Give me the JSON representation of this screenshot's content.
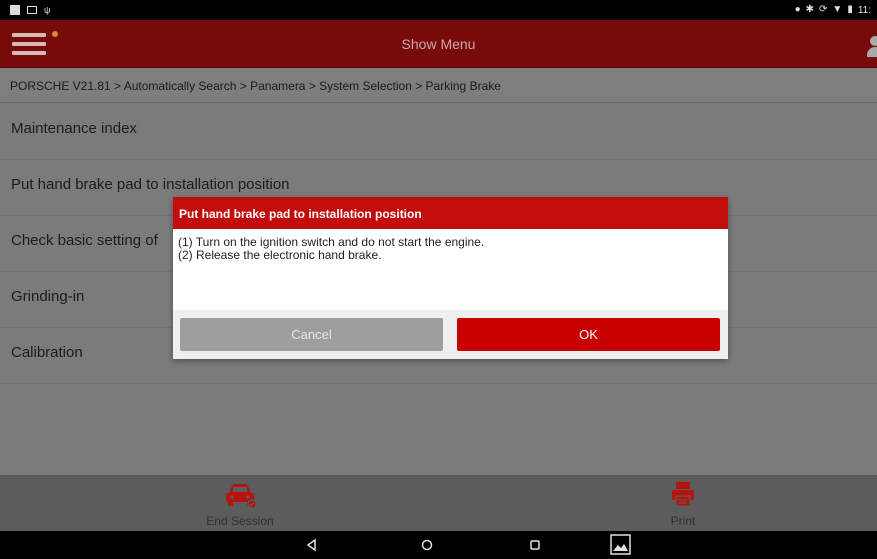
{
  "status_bar": {
    "left_icons": [
      "notification-icon",
      "message-icon",
      "usb-icon"
    ],
    "right_icons": [
      "location-icon",
      "bluetooth-icon",
      "sync-icon",
      "wifi-icon",
      "battery-icon"
    ],
    "time": "11:"
  },
  "header": {
    "title": "Show Menu",
    "menu_icon": "hamburger-menu-icon",
    "user_icon": "user-icon"
  },
  "breadcrumb": {
    "text": "PORSCHE V21.81 > Automatically Search > Panamera > System Selection > Parking Brake"
  },
  "menu": {
    "items": [
      {
        "label": "Maintenance index"
      },
      {
        "label": "Put hand brake pad to installation position"
      },
      {
        "label": "Check basic setting of"
      },
      {
        "label": "Grinding-in"
      },
      {
        "label": "Calibration"
      }
    ]
  },
  "dialog": {
    "title": "Put hand brake pad to installation position",
    "lines": [
      "(1) Turn on the ignition switch and do not start the engine.",
      "(2) Release the electronic hand brake."
    ],
    "cancel_label": "Cancel",
    "ok_label": "OK"
  },
  "bottom_bar": {
    "end_session_label": "End Session",
    "print_label": "Print"
  },
  "nav_bar": {
    "buttons": [
      "back-icon",
      "home-icon",
      "recent-apps-icon",
      "gallery-icon"
    ]
  },
  "colors": {
    "header_bg": "#790a0a",
    "dialog_title_bg": "#c30d0d",
    "ok_button": "#c80000",
    "cancel_button": "#9e9e9e",
    "overlay_gray": "#7b7b7b",
    "icon_red": "#b3140f"
  }
}
